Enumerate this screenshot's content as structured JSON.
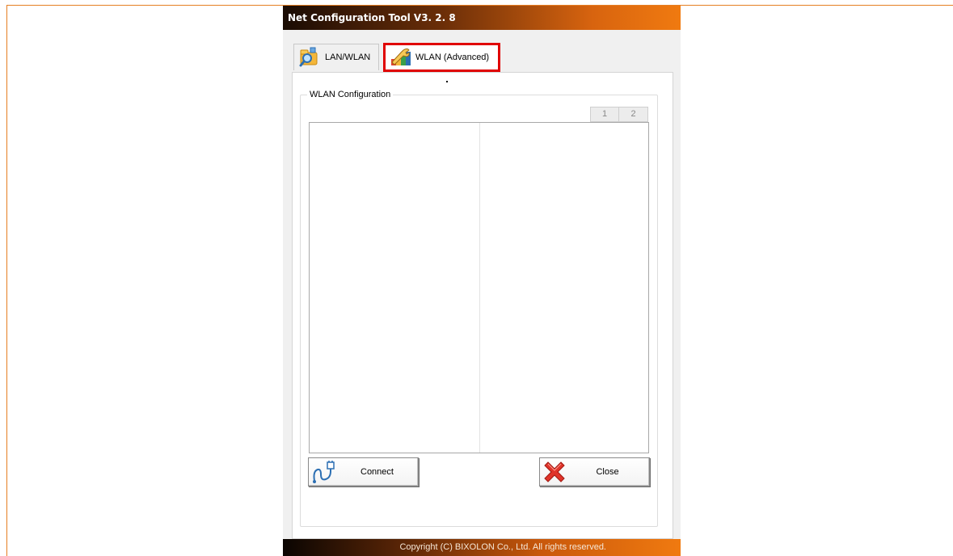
{
  "window": {
    "title": "Net Configuration Tool V3. 2. 8"
  },
  "tabs": [
    {
      "label": "LAN/WLAN",
      "icon": "folder-magnifier-icon",
      "selected": false
    },
    {
      "label": "WLAN (Advanced)",
      "icon": "wrench-config-icon",
      "selected": true
    }
  ],
  "group": {
    "legend": "WLAN Configuration"
  },
  "pager": {
    "pages": [
      "1",
      "2"
    ]
  },
  "buttons": {
    "connect_label": "Connect",
    "close_label": "Close"
  },
  "footer": {
    "copyright": "Copyright (C) BIXOLON Co., Ltd. All rights reserved."
  },
  "colors": {
    "accent_orange": "#f07a10",
    "highlight_red": "#e00000"
  }
}
